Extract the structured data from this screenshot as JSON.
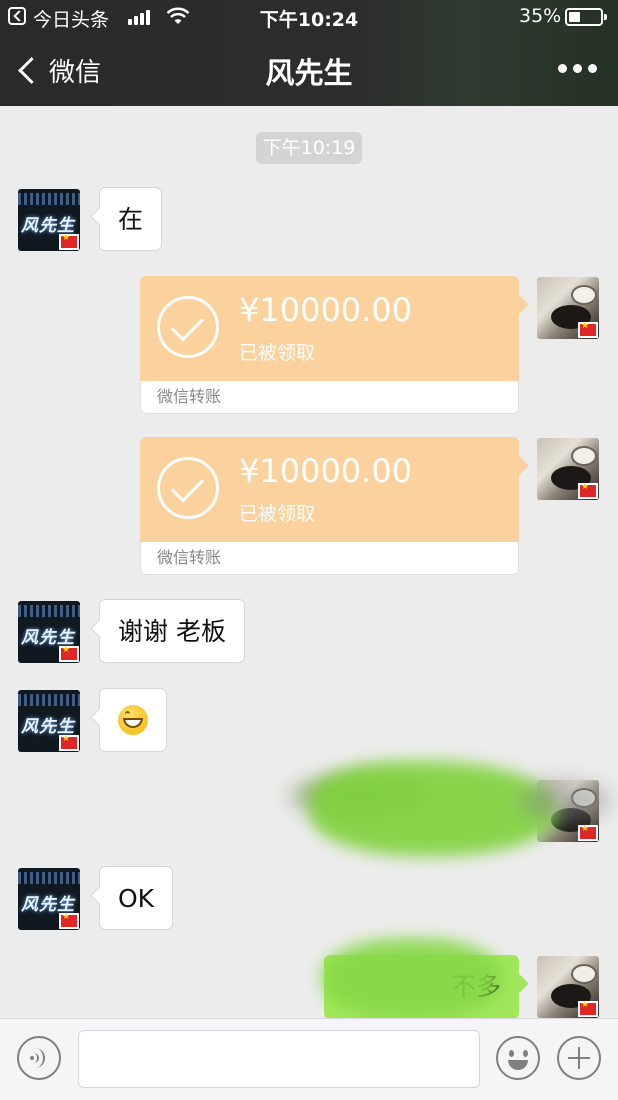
{
  "status_bar": {
    "back_app": "今日头条",
    "time": "下午10:24",
    "battery_percent": "35%",
    "battery_level": 0.35,
    "icons": [
      "back-app-icon",
      "signal-icon",
      "wifi-icon",
      "battery-icon"
    ]
  },
  "nav": {
    "back_label": "微信",
    "title": "风先生",
    "more_icon": "more-dots-icon"
  },
  "chat": {
    "timestamp": "下午10:19",
    "messages": [
      {
        "from": "friend",
        "type": "text",
        "text": "在"
      },
      {
        "from": "me",
        "type": "transfer",
        "amount": "¥10000.00",
        "status": "已被领取",
        "label": "微信转账"
      },
      {
        "from": "me",
        "type": "transfer",
        "amount": "¥10000.00",
        "status": "已被领取",
        "label": "微信转账"
      },
      {
        "from": "friend",
        "type": "text",
        "text": "谢谢 老板"
      },
      {
        "from": "friend",
        "type": "emoji",
        "emoji": "grinning-emoji"
      },
      {
        "from": "me",
        "type": "text",
        "text": "",
        "redacted": true
      },
      {
        "from": "friend",
        "type": "text",
        "text": "OK"
      },
      {
        "from": "me",
        "type": "text",
        "text": "不多",
        "partially_redacted": true
      }
    ],
    "friend_avatar_text": "风先生"
  },
  "input_bar": {
    "text": "",
    "icons": [
      "voice-icon",
      "emoji-icon",
      "plus-icon"
    ]
  },
  "colors": {
    "header_bg": "#2a2a2a",
    "chat_bg": "#ececec",
    "transfer_orange": "#fbd19d",
    "outgoing_green": "#a0e75a"
  }
}
